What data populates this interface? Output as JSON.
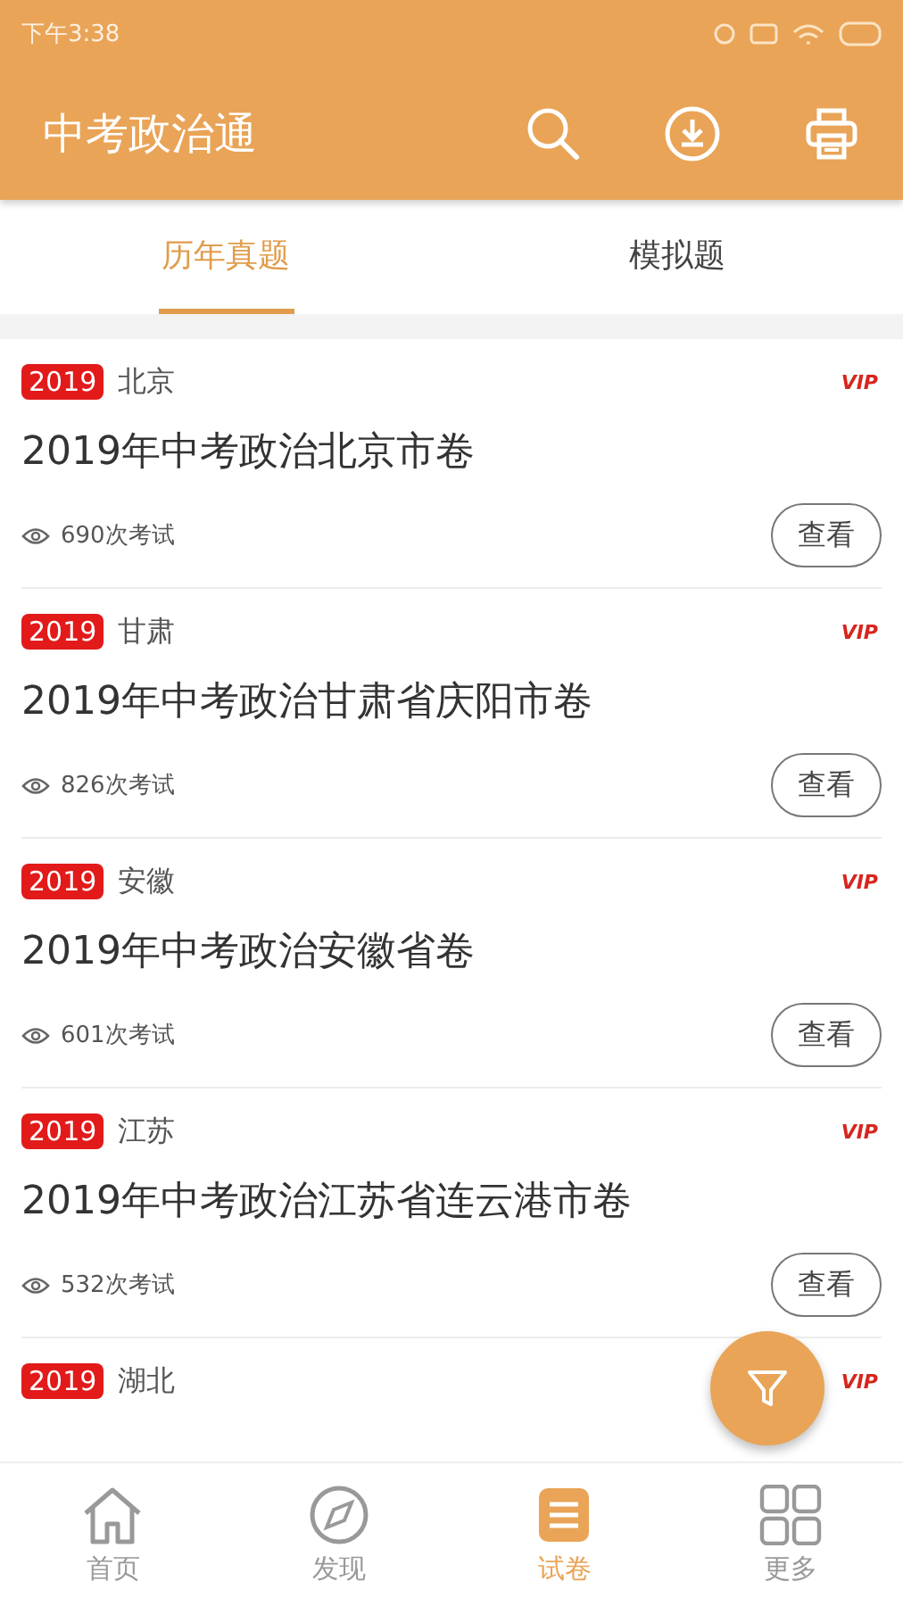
{
  "status_bar": {
    "time": "下午3:38"
  },
  "app_bar": {
    "title": "中考政治通"
  },
  "tabs": [
    {
      "label": "历年真题",
      "selected": true
    },
    {
      "label": "模拟题",
      "selected": false
    }
  ],
  "papers": [
    {
      "year": "2019",
      "region": "北京",
      "vip": "VIP",
      "title": "2019年中考政治北京市卷",
      "count": "690次考试",
      "button": "查看"
    },
    {
      "year": "2019",
      "region": "甘肃",
      "vip": "VIP",
      "title": "2019年中考政治甘肃省庆阳市卷",
      "count": "826次考试",
      "button": "查看"
    },
    {
      "year": "2019",
      "region": "安徽",
      "vip": "VIP",
      "title": "2019年中考政治安徽省卷",
      "count": "601次考试",
      "button": "查看"
    },
    {
      "year": "2019",
      "region": "江苏",
      "vip": "VIP",
      "title": "2019年中考政治江苏省连云港市卷",
      "count": "532次考试",
      "button": "查看"
    },
    {
      "year": "2019",
      "region": "湖北",
      "vip": "VIP"
    }
  ],
  "bottom_nav": [
    {
      "label": "首页",
      "kind": "home",
      "selected": false
    },
    {
      "label": "发现",
      "kind": "discover",
      "selected": false
    },
    {
      "label": "试卷",
      "kind": "papers",
      "selected": true
    },
    {
      "label": "更多",
      "kind": "more",
      "selected": false
    }
  ]
}
